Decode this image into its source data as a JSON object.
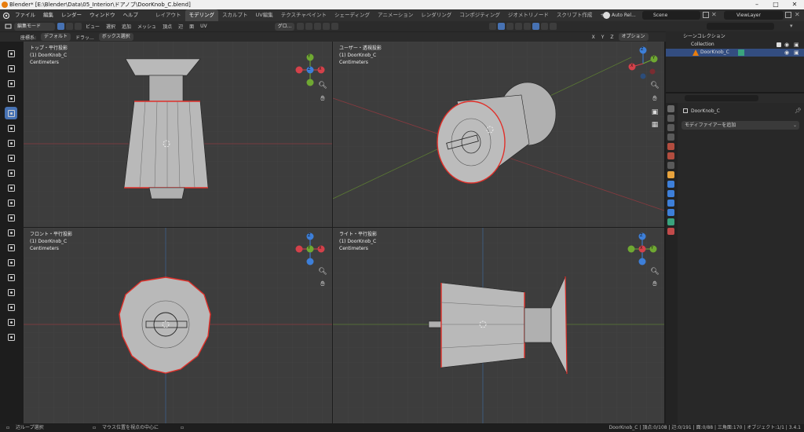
{
  "window": {
    "title": "Blender* [E:\\Blender\\Data\\05_Interior\\ドアノブ\\DoorKnob_C.blend]"
  },
  "menubar": {
    "menus": [
      "ファイル",
      "編集",
      "レンダー",
      "ウィンドウ",
      "ヘルプ"
    ],
    "workspaces": [
      "レイアウト",
      "モデリング",
      "スカルプト",
      "UV編集",
      "テクスチャペイント",
      "シェーディング",
      "アニメーション",
      "レンダリング",
      "コンポジティング",
      "ジオメトリノード",
      "スクリプト作成"
    ],
    "active_workspace": "モデリング",
    "add_tab": "+",
    "scene_label": "Auto Rel...",
    "scene": "Scene",
    "view_layer": "ViewLayer"
  },
  "header": {
    "mode": "編集モード",
    "menus": [
      "ビュー",
      "選択",
      "追加",
      "メッシュ",
      "頂点",
      "辺",
      "面",
      "UV"
    ],
    "transform": "グロ...",
    "options": "オプション",
    "axes": [
      "X",
      "Y",
      "Z"
    ],
    "coord_label": "座標系:",
    "coord_value": "デフォルト",
    "drag_label": "ドラッ...",
    "select_label": "ボックス選択"
  },
  "viewports": [
    {
      "name": "トップ・平行投影",
      "object": "(1) DoorKnob_C",
      "units": "Centimeters"
    },
    {
      "name": "ユーザー・透視投影",
      "object": "(1) DoorKnob_C",
      "units": "Centimeters"
    },
    {
      "name": "フロント・平行投影",
      "object": "(1) DoorKnob_C",
      "units": "Centimeters"
    },
    {
      "name": "ライト・平行投影",
      "object": "(1) DoorKnob_C",
      "units": "Centimeters"
    }
  ],
  "gizmo_axes": {
    "x": "X",
    "y": "Y",
    "z": "Z"
  },
  "outliner": {
    "root": "シーンコレクション",
    "collection": "Collection",
    "object": "DoorKnob_C"
  },
  "properties": {
    "object": "DoorKnob_C",
    "add_modifier": "モディファイアーを追加"
  },
  "statusbar": {
    "left": "辺ループ選択",
    "middle": "マウス位置を視点の中心に",
    "right": "DoorKnob_C | 頂点:0/108 | 辺:0/191 | 面:0/88 | 三角面:170 | オブジェクト:1/1 | 3.4.1"
  },
  "colors": {
    "accent": "#4772b3",
    "x_axis": "#d4414a",
    "y_axis": "#6fa832",
    "z_axis": "#3d7fd9",
    "edge_seam": "#e0302a",
    "viewport_bg": "#3d3d3d",
    "mesh_face": "#b5b5b5"
  },
  "icons": [
    "blender-logo-icon",
    "cursor-icon",
    "move-icon",
    "rotate-icon",
    "scale-icon",
    "transform-icon",
    "annotate-icon",
    "measure-icon",
    "extrude-icon",
    "inset-icon",
    "bevel-icon",
    "loopcut-icon",
    "knife-icon",
    "polybuild-icon",
    "spin-icon",
    "smooth-icon",
    "edgeslide-icon",
    "shrink-icon",
    "shear-icon",
    "rip-icon",
    "zoom-icon",
    "hand-icon",
    "camera-icon",
    "grid-icon"
  ]
}
